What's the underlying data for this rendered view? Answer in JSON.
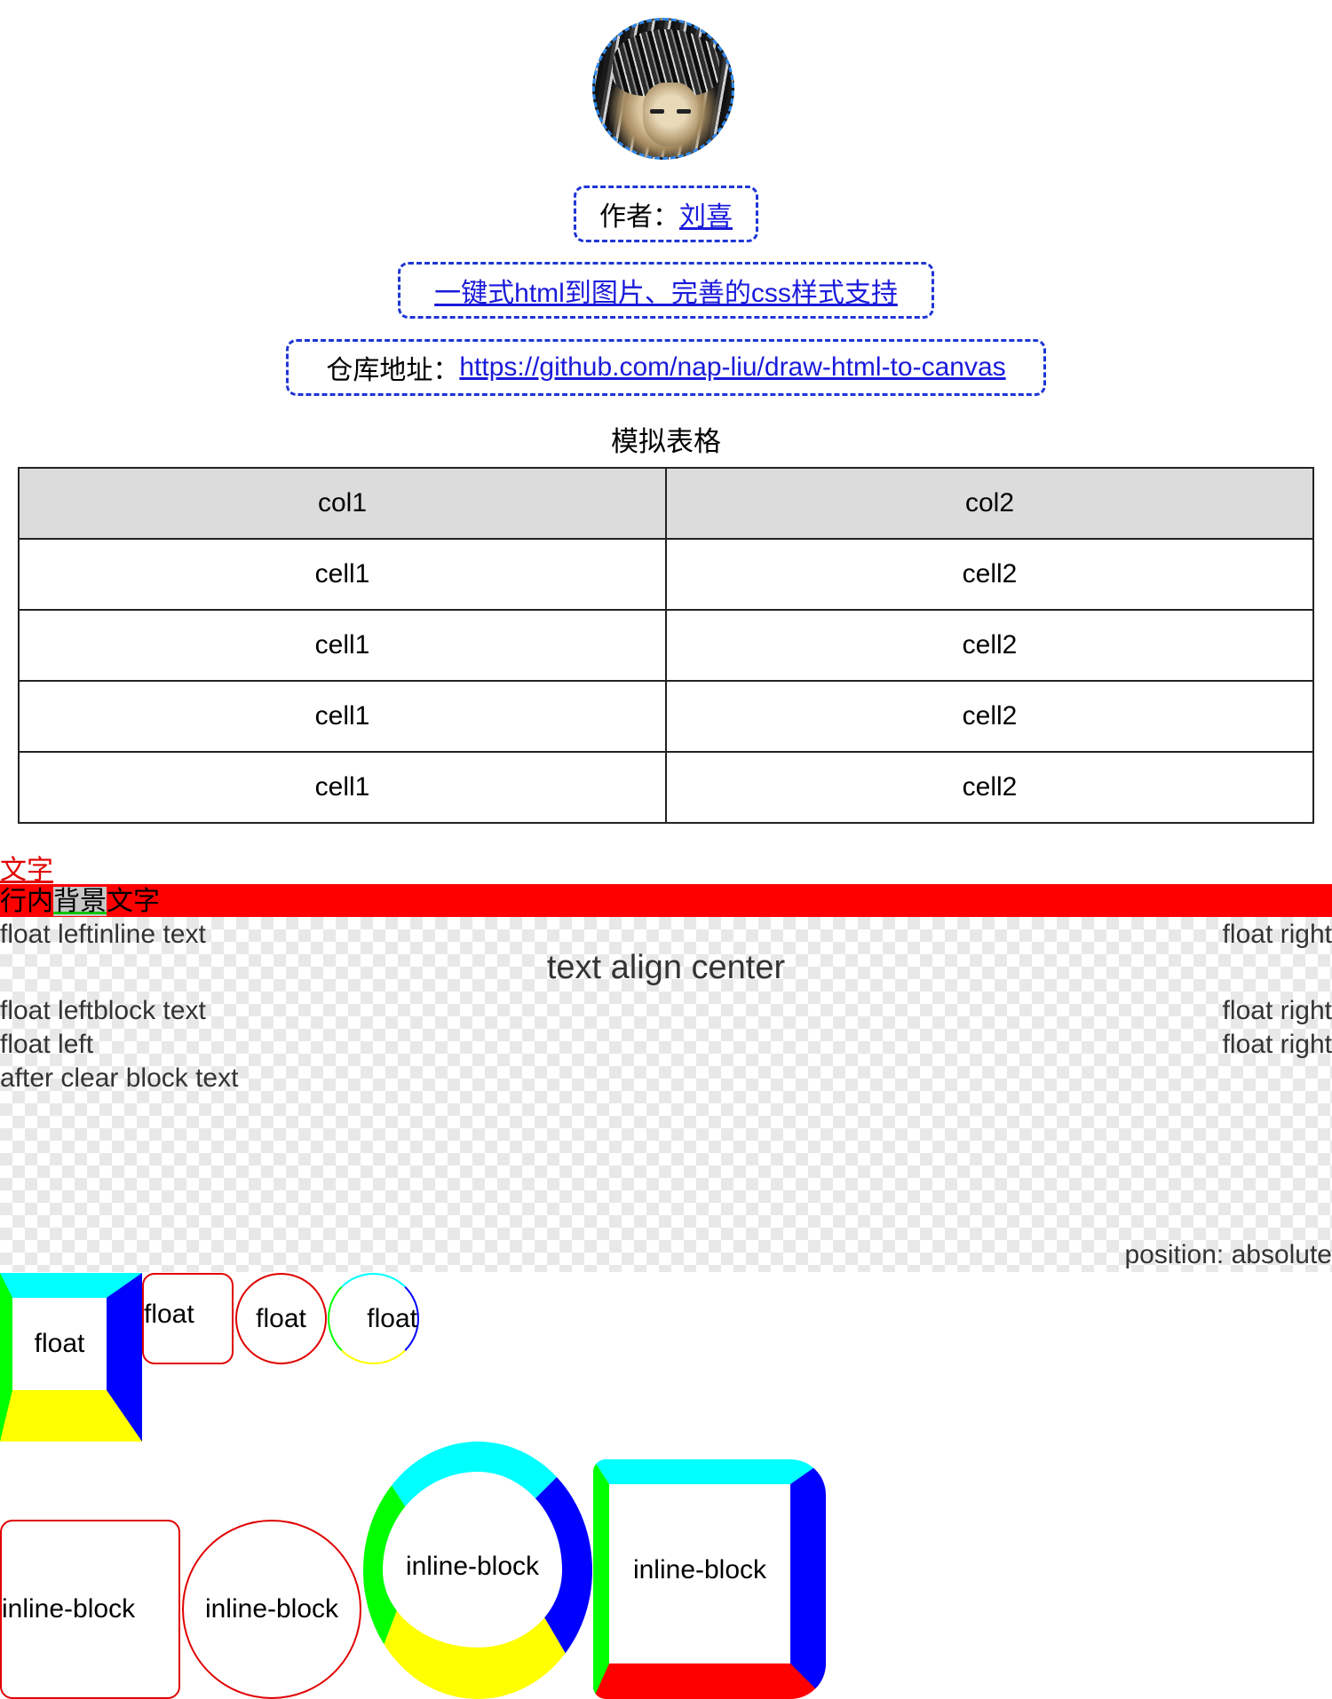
{
  "header": {
    "author_label": "作者：",
    "author_name": "刘喜",
    "tagline": "一键式html到图片、完善的css样式支持",
    "repo_label": "仓库地址：",
    "repo_url": "https://github.com/nap-liu/draw-html-to-canvas"
  },
  "table": {
    "caption": "模拟表格",
    "columns": [
      "col1",
      "col2"
    ],
    "rows": [
      [
        "cell1",
        "cell2"
      ],
      [
        "cell1",
        "cell2"
      ],
      [
        "cell1",
        "cell2"
      ],
      [
        "cell1",
        "cell2"
      ]
    ]
  },
  "text_demo": {
    "red_text": "文字",
    "inline_prefix": "行内",
    "inline_highlight": "背景",
    "inline_suffix": "文字"
  },
  "float_demo": {
    "row1_left": "float left",
    "row1_inline": "inline text",
    "row1_right": "float right",
    "center": "text align center",
    "row2_left": "float left",
    "row2_block": "block text",
    "row2_right": "float right",
    "row3_left": "float left",
    "row3_right": "float right",
    "after_clear": "after clear block text",
    "absolute": "position: absolute"
  },
  "shapes": {
    "float_label": "float",
    "inline_block_label": "inline-block"
  },
  "colors": {
    "link": "#1a1adb",
    "dash_border": "#1e35d6",
    "red": "#ff0000",
    "cyan": "#00ffff",
    "blue": "#0000ff",
    "yellow": "#ffff00",
    "green": "#00ff00"
  }
}
